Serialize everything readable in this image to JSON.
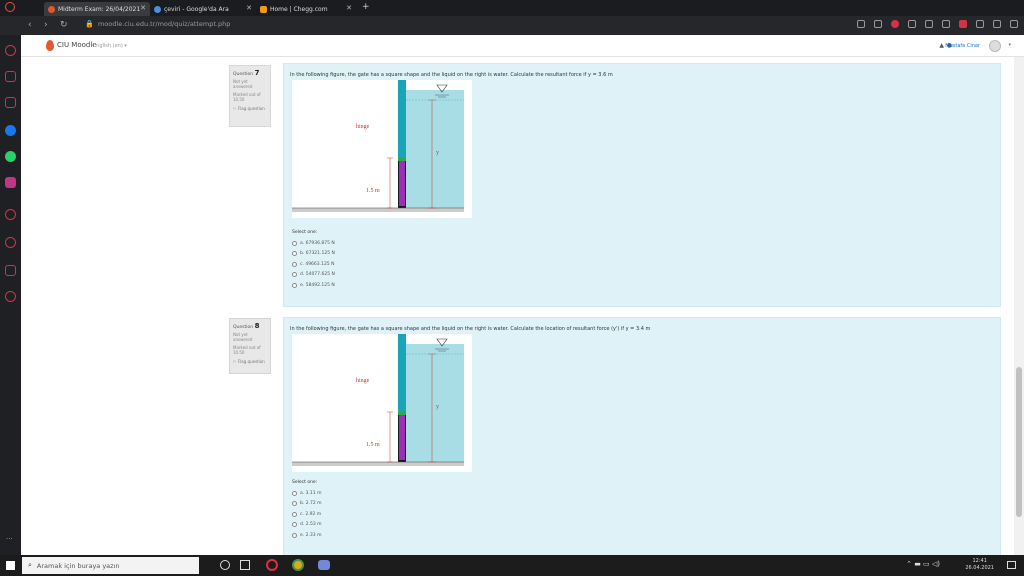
{
  "browser": {
    "tabs": [
      {
        "label": "Midterm Exam: 26/04/2021",
        "color": "#e0582b"
      },
      {
        "label": "çeviri - Google'da Ara",
        "color": "#4a90e2"
      },
      {
        "label": "Home | Chegg.com",
        "color": "#f39a1b"
      }
    ],
    "new_tab": "+",
    "url": "moodle.ciu.edu.tr/mod/quiz/attempt.php"
  },
  "header": {
    "logo_text": "CIU Moodle",
    "language": "English (en) ▾",
    "user_name": "Mustafa Cinar"
  },
  "questions": [
    {
      "number_label": "Question",
      "number": "7",
      "status": "Not yet answered",
      "marked": "Marked out of 10.50",
      "flag": "Flag question",
      "text": "In the following figure, the gate has a square shape and the liquid on the right is water. Calculate the resultant force if y = 3.6 m",
      "figure": {
        "hinge_label": "hinge",
        "y_label": "y",
        "dim_label": "1.5 m"
      },
      "select_label": "Select one:",
      "options": [
        "a. 67936.875 N",
        "b. 67321.125 N",
        "c. 49663.125 N",
        "d. 54077.625 N",
        "e. 58492.125 N"
      ]
    },
    {
      "number_label": "Question",
      "number": "8",
      "status": "Not yet answered",
      "marked": "Marked out of 10.50",
      "flag": "Flag question",
      "text": "In the following figure, the gate has a square shape and the liquid on the right is water. Calculate the location of resultant force (y') if y = 3.4 m",
      "figure": {
        "hinge_label": "hinge",
        "y_label": "y",
        "dim_label": "1.5 m"
      },
      "select_label": "Select one:",
      "options": [
        "a. 3.11 m",
        "b. 2.72 m",
        "c. 2.92 m",
        "d. 2.53 m",
        "e. 2.33 m"
      ]
    }
  ],
  "taskbar": {
    "search_placeholder": "Aramak için buraya yazın",
    "time": "12:41",
    "date": "26.04.2021"
  },
  "colors": {
    "question_bg": "#def2f8",
    "water": "#a8dde6",
    "gate": "#9b2fb5",
    "wall": "#1ba3b6",
    "accent": "#e45a2c"
  }
}
